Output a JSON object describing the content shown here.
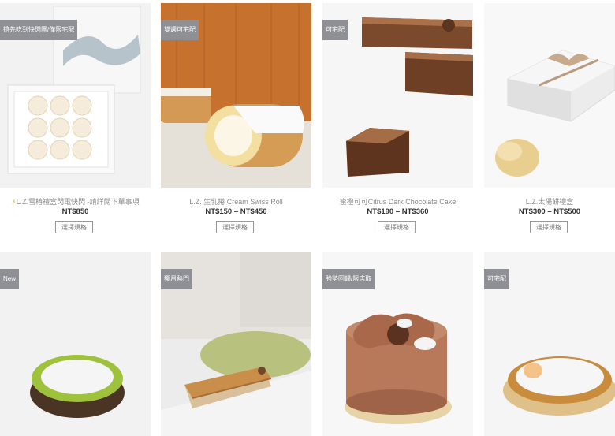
{
  "products": [
    {
      "badge": "搶先吃到快閃團/僅限宅配",
      "title": "L.Z.雪椿禮盒閃電快閃 -請詳閱下單事項",
      "has_bolt": true,
      "price": "NT$850",
      "button": "選擇規格"
    },
    {
      "badge": "雙週可宅配",
      "title": "L.Z. 生乳捲 Cream Swiss Roll",
      "price": "NT$150 – NT$450",
      "button": "選擇規格"
    },
    {
      "badge": "可宅配",
      "title": "蜜橙可可Citrus Dark Chocolate Cake",
      "price": "NT$190 – NT$360",
      "button": "選擇規格"
    },
    {
      "badge": "",
      "title": "L.Z.太陽餅禮盒",
      "price": "NT$300 – NT$500",
      "button": "選擇規格"
    },
    {
      "badge": "New"
    },
    {
      "badge": "獨月熱門"
    },
    {
      "badge": "強勢回歸/限店取"
    },
    {
      "badge": "可宅配"
    }
  ],
  "colors": {
    "badge_bg": "#8e9096",
    "price": "#333333",
    "title": "#8a8a8a"
  },
  "icons": {
    "bolt": "lightning-bolt-icon"
  }
}
